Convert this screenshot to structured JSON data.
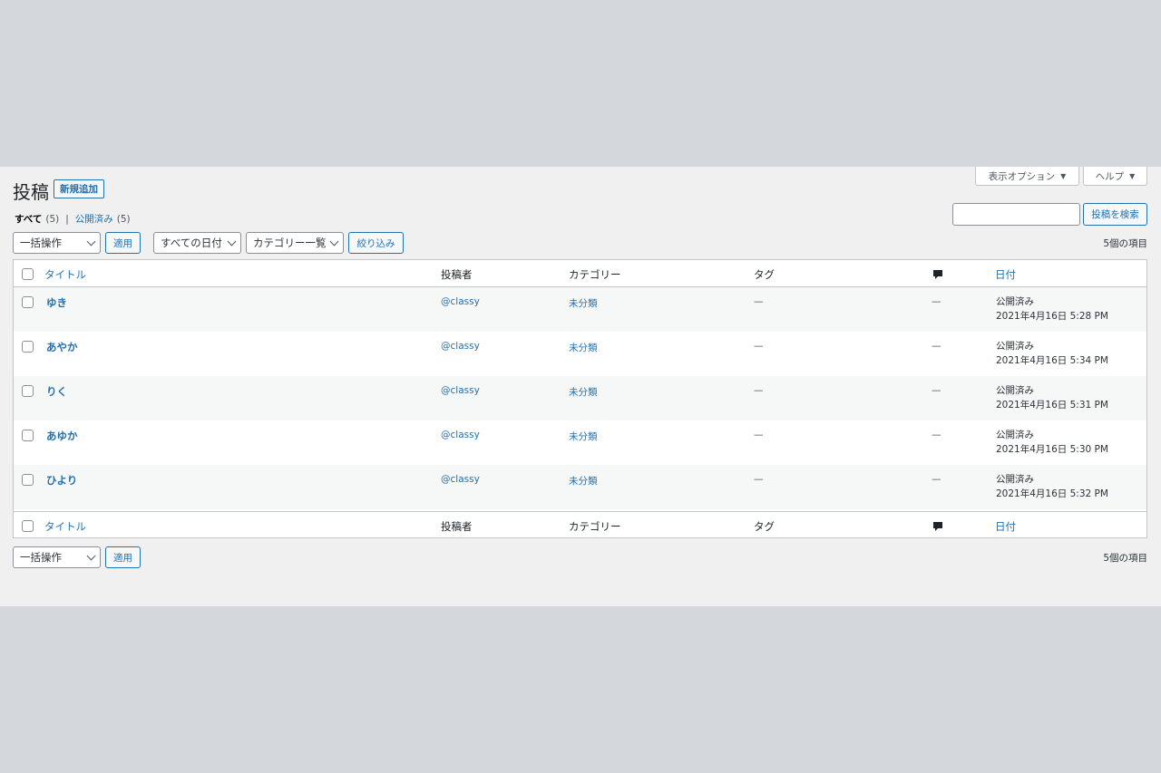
{
  "screen_meta": {
    "options_label": "表示オプション",
    "help_label": "ヘルプ",
    "arrow": "▼"
  },
  "page": {
    "title": "投稿",
    "add_new_label": "新規追加"
  },
  "views": {
    "all_label": "すべて",
    "all_count": "(5)",
    "separator": "|",
    "published_label": "公開済み",
    "published_count": "(5)"
  },
  "search": {
    "value": "",
    "button_label": "投稿を検索"
  },
  "tablenav": {
    "bulk_action": "一括操作",
    "apply_label": "適用",
    "date_filter": "すべての日付",
    "category_filter": "カテゴリー一覧",
    "filter_label": "絞り込み",
    "items_count": "5個の項目"
  },
  "table": {
    "columns": {
      "title": "タイトル",
      "author": "投稿者",
      "category": "カテゴリー",
      "tags": "タグ",
      "comments_icon": "comment-bubble-icon",
      "date": "日付"
    },
    "rows": [
      {
        "title": "ゆき",
        "author": "@classy",
        "category": "未分類",
        "tags": "—",
        "comments": "—",
        "status": "公開済み",
        "date": "2021年4月16日 5:28 PM"
      },
      {
        "title": "あやか",
        "author": "@classy",
        "category": "未分類",
        "tags": "—",
        "comments": "—",
        "status": "公開済み",
        "date": "2021年4月16日 5:34 PM"
      },
      {
        "title": "りく",
        "author": "@classy",
        "category": "未分類",
        "tags": "—",
        "comments": "—",
        "status": "公開済み",
        "date": "2021年4月16日 5:31 PM"
      },
      {
        "title": "あゆか",
        "author": "@classy",
        "category": "未分類",
        "tags": "—",
        "comments": "—",
        "status": "公開済み",
        "date": "2021年4月16日 5:30 PM"
      },
      {
        "title": "ひより",
        "author": "@classy",
        "category": "未分類",
        "tags": "—",
        "comments": "—",
        "status": "公開済み",
        "date": "2021年4月16日 5:32 PM"
      }
    ]
  },
  "colors": {
    "link": "#2271b1",
    "background": "#f0f0f1",
    "outer": "#d4d7db"
  }
}
